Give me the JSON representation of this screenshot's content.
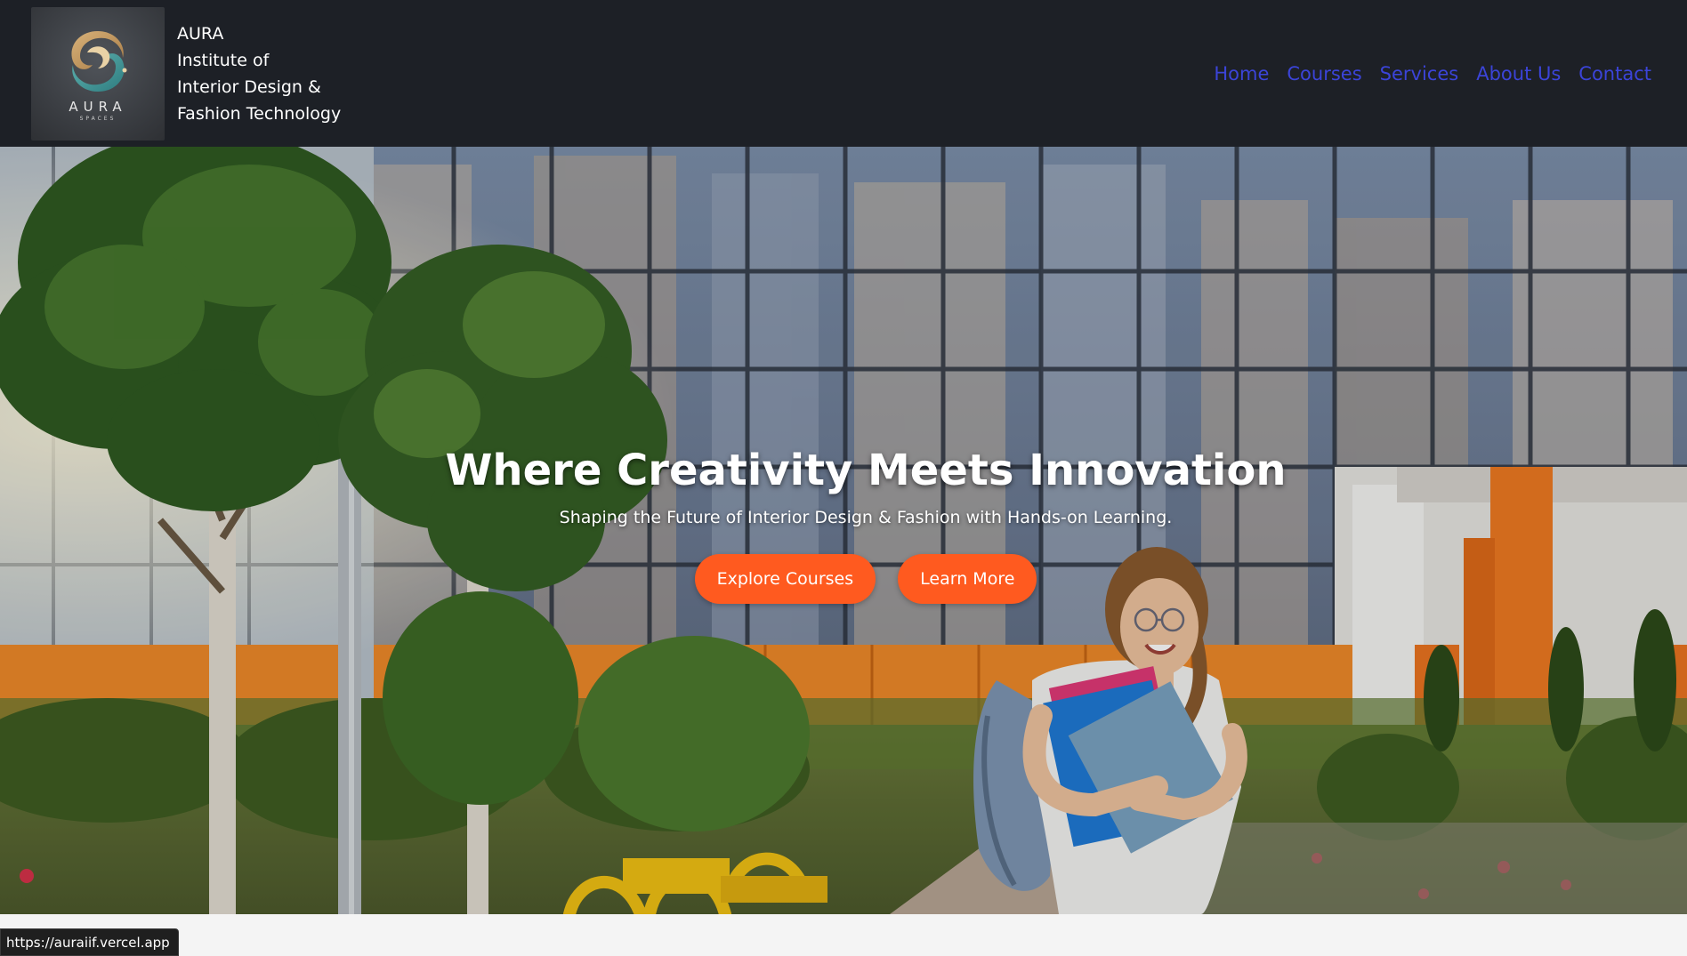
{
  "header": {
    "logo": {
      "wordmark": "AURA",
      "sub": "SPACES"
    },
    "brand_lines": [
      "AURA",
      "Institute of",
      "Interior Design &",
      "Fashion Technology"
    ],
    "nav": [
      {
        "label": "Home"
      },
      {
        "label": "Courses"
      },
      {
        "label": "Services"
      },
      {
        "label": "About Us"
      },
      {
        "label": "Contact"
      }
    ]
  },
  "hero": {
    "title": "Where Creativity Meets Innovation",
    "subtitle": "Shaping the Future of Interior Design & Fashion with Hands-on Learning.",
    "buttons": {
      "primary": "Explore Courses",
      "secondary": "Learn More"
    }
  },
  "status_bar": {
    "url": "https://auraiif.vercel.app"
  },
  "colors": {
    "header_bg": "#1d2026",
    "nav_link": "#3b44d8",
    "button": "#ff5a1f"
  }
}
